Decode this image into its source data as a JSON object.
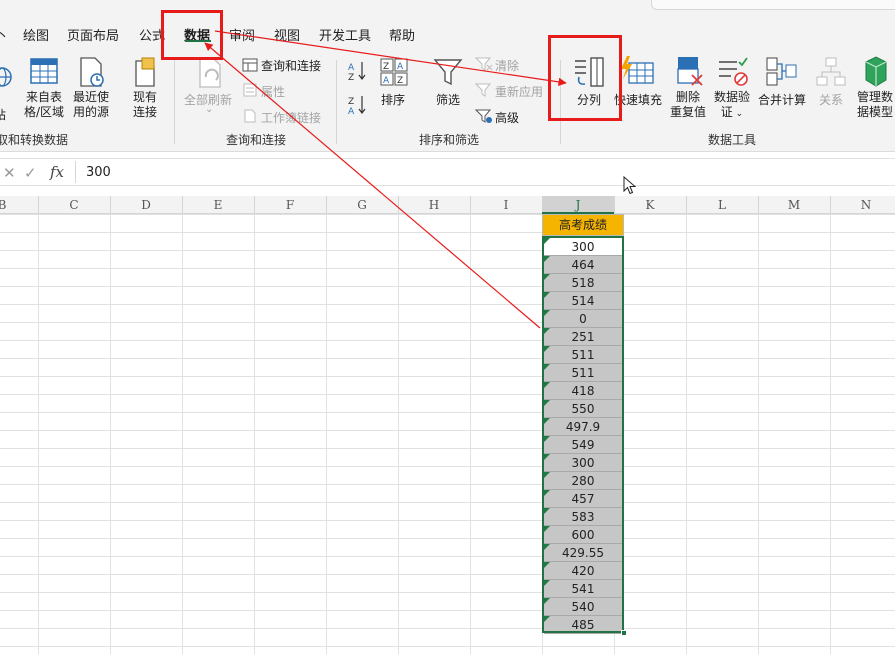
{
  "tabs": [
    {
      "label": "丶"
    },
    {
      "label": "绘图"
    },
    {
      "label": "页面布局"
    },
    {
      "label": "公式"
    },
    {
      "label": "数据"
    },
    {
      "label": "审阅"
    },
    {
      "label": "视图"
    },
    {
      "label": "开发工具"
    },
    {
      "label": "帮助"
    }
  ],
  "active_tab": "数据",
  "ribbon": {
    "get_transform": {
      "web_cut_line1": "站",
      "from_table_line1": "来自表",
      "from_table_line2": "格/区域",
      "recent_sources_line1": "最近使",
      "recent_sources_line2": "用的源",
      "existing_conn_line1": "现有",
      "existing_conn_line2": "连接",
      "group_label": "取和转换数据"
    },
    "queries": {
      "refresh_all": "全部刷新",
      "queries_connections": "查询和连接",
      "properties": "属性",
      "workbook_links": "工作簿链接",
      "group_label": "查询和连接"
    },
    "sort_filter": {
      "sort": "排序",
      "filter": "筛选",
      "clear": "清除",
      "reapply": "重新应用",
      "advanced": "高级",
      "group_label": "排序和筛选"
    },
    "data_tools": {
      "text_to_columns": "分列",
      "flash_fill": "快速填充",
      "remove_dup_line1": "删除",
      "remove_dup_line2": "重复值",
      "validation_line1": "数据验",
      "validation_line2": "证",
      "consolidate": "合并计算",
      "relationships": "关系",
      "manage_model_line1": "管理数",
      "manage_model_line2": "据模型",
      "group_label": "数据工具"
    }
  },
  "formula_bar": {
    "cancel_glyph": "✕",
    "enter_glyph": "✓",
    "fx_label": "fx",
    "value": "300"
  },
  "columns": [
    "B",
    "C",
    "D",
    "E",
    "F",
    "G",
    "H",
    "I",
    "J",
    "K",
    "L",
    "M",
    "N"
  ],
  "selected_column": "J",
  "sheet": {
    "header": "高考成绩",
    "values": [
      "300",
      "464",
      "518",
      "514",
      "0",
      "251",
      "511",
      "511",
      "418",
      "550",
      "497.9",
      "549",
      "300",
      "280",
      "457",
      "583",
      "600",
      "429.55",
      "420",
      "541",
      "540",
      "485"
    ]
  },
  "colors": {
    "accent_green": "#217346",
    "header_fill": "#f5b400",
    "annotation_red": "#e81b1b"
  }
}
